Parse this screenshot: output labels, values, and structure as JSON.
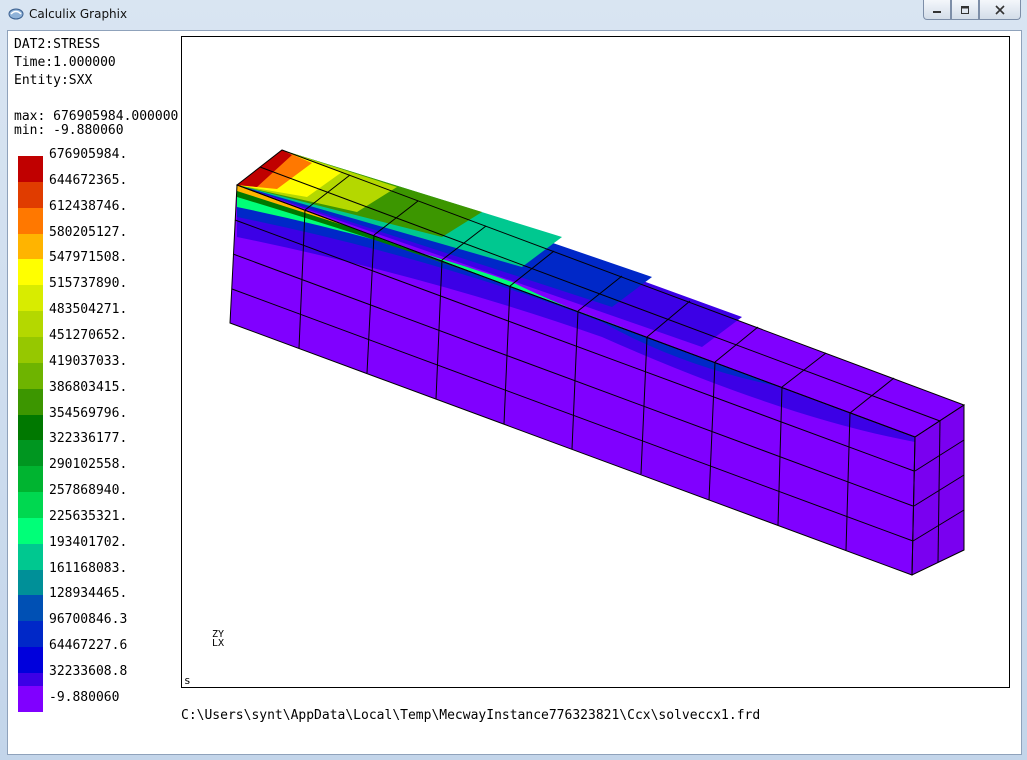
{
  "window": {
    "title": "Calculix Graphix",
    "controls": [
      "minimize",
      "restore",
      "close"
    ]
  },
  "header": {
    "dataset": "DAT2:STRESS",
    "time": "Time:1.000000",
    "entity": "Entity:SXX",
    "max": "max: 676905984.000000",
    "min": "min: -9.880060"
  },
  "legend": {
    "items": [
      {
        "label": "676905984.",
        "color": "#c00000"
      },
      {
        "label": "644672365.",
        "color": "#e03c00"
      },
      {
        "label": "612438746.",
        "color": "#ff7800"
      },
      {
        "label": "580205127.",
        "color": "#ffb400"
      },
      {
        "label": "547971508.",
        "color": "#ffff00"
      },
      {
        "label": "515737890.",
        "color": "#d8ec00"
      },
      {
        "label": "483504271.",
        "color": "#b4d800"
      },
      {
        "label": "451270652.",
        "color": "#96c800"
      },
      {
        "label": "419037033.",
        "color": "#6eb400"
      },
      {
        "label": "386803415.",
        "color": "#3c9600"
      },
      {
        "label": "354569796.",
        "color": "#007800"
      },
      {
        "label": "322336177.",
        "color": "#009620"
      },
      {
        "label": "290102558.",
        "color": "#00b430"
      },
      {
        "label": "257868940.",
        "color": "#00d850"
      },
      {
        "label": "225635321.",
        "color": "#00ff78"
      },
      {
        "label": "193401702.",
        "color": "#00c890"
      },
      {
        "label": "161168083.",
        "color": "#009098"
      },
      {
        "label": "128934465.",
        "color": "#0050b4"
      },
      {
        "label": "96700846.3",
        "color": "#0028c8"
      },
      {
        "label": "64467227.6",
        "color": "#0000dc"
      },
      {
        "label": "32233608.8",
        "color": "#3c00e6"
      },
      {
        "label": "-9.880060",
        "color": "#8000ff"
      }
    ]
  },
  "viewport": {
    "corner_mark": "s",
    "triad": [
      "Z",
      "Y",
      "X"
    ]
  },
  "status": {
    "file_path": "C:\\Users\\synt\\AppData\\Local\\Temp\\MecwayInstance776323821\\Ccx\\solveccx1.frd"
  }
}
